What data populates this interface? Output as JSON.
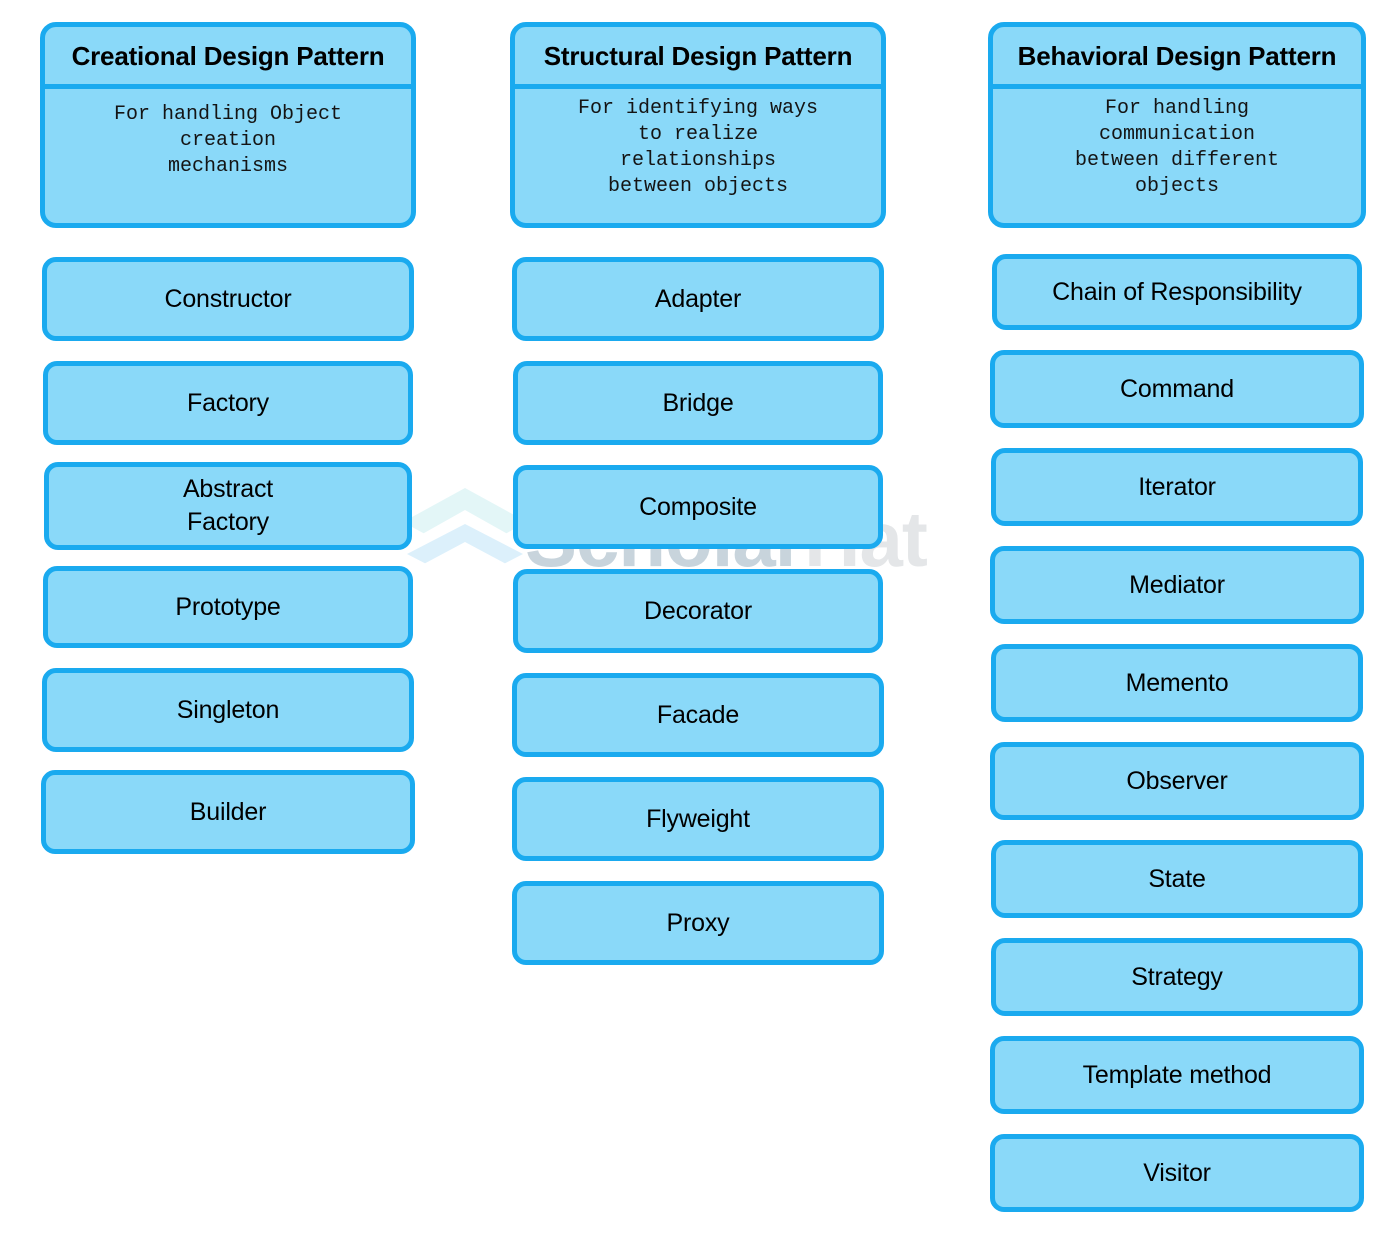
{
  "watermark": {
    "text_primary": "Scholar",
    "text_secondary": "Hat",
    "logo_name": "scholarhat-stacked-diamond-logo",
    "color_primary": "#c8d4dc",
    "color_secondary": "#e4e6e8"
  },
  "theme": {
    "box_fill": "#8ad9f9",
    "box_border": "#1aaaef",
    "text_color": "#000000",
    "page_background": "#ffffff"
  },
  "columns": [
    {
      "id": "creational",
      "title": "Creational Design Pattern",
      "description": "For handling Object\ncreation\nmechanisms",
      "items": [
        {
          "label": "Constructor"
        },
        {
          "label": "Factory"
        },
        {
          "label": "Abstract\nFactory"
        },
        {
          "label": "Prototype"
        },
        {
          "label": "Singleton"
        },
        {
          "label": "Builder"
        }
      ]
    },
    {
      "id": "structural",
      "title": "Structural Design Pattern",
      "description": "For identifying ways\nto realize\nrelationships\nbetween objects",
      "items": [
        {
          "label": "Adapter"
        },
        {
          "label": "Bridge"
        },
        {
          "label": "Composite"
        },
        {
          "label": "Decorator"
        },
        {
          "label": "Facade"
        },
        {
          "label": "Flyweight"
        },
        {
          "label": "Proxy"
        }
      ]
    },
    {
      "id": "behavioral",
      "title": "Behavioral Design Pattern",
      "description": "For handling\ncommunication\nbetween different\nobjects",
      "items": [
        {
          "label": "Chain of Responsibility"
        },
        {
          "label": "Command"
        },
        {
          "label": "Iterator"
        },
        {
          "label": "Mediator"
        },
        {
          "label": "Memento"
        },
        {
          "label": "Observer"
        },
        {
          "label": "State"
        },
        {
          "label": "Strategy"
        },
        {
          "label": "Template method"
        },
        {
          "label": "Visitor"
        }
      ]
    }
  ]
}
